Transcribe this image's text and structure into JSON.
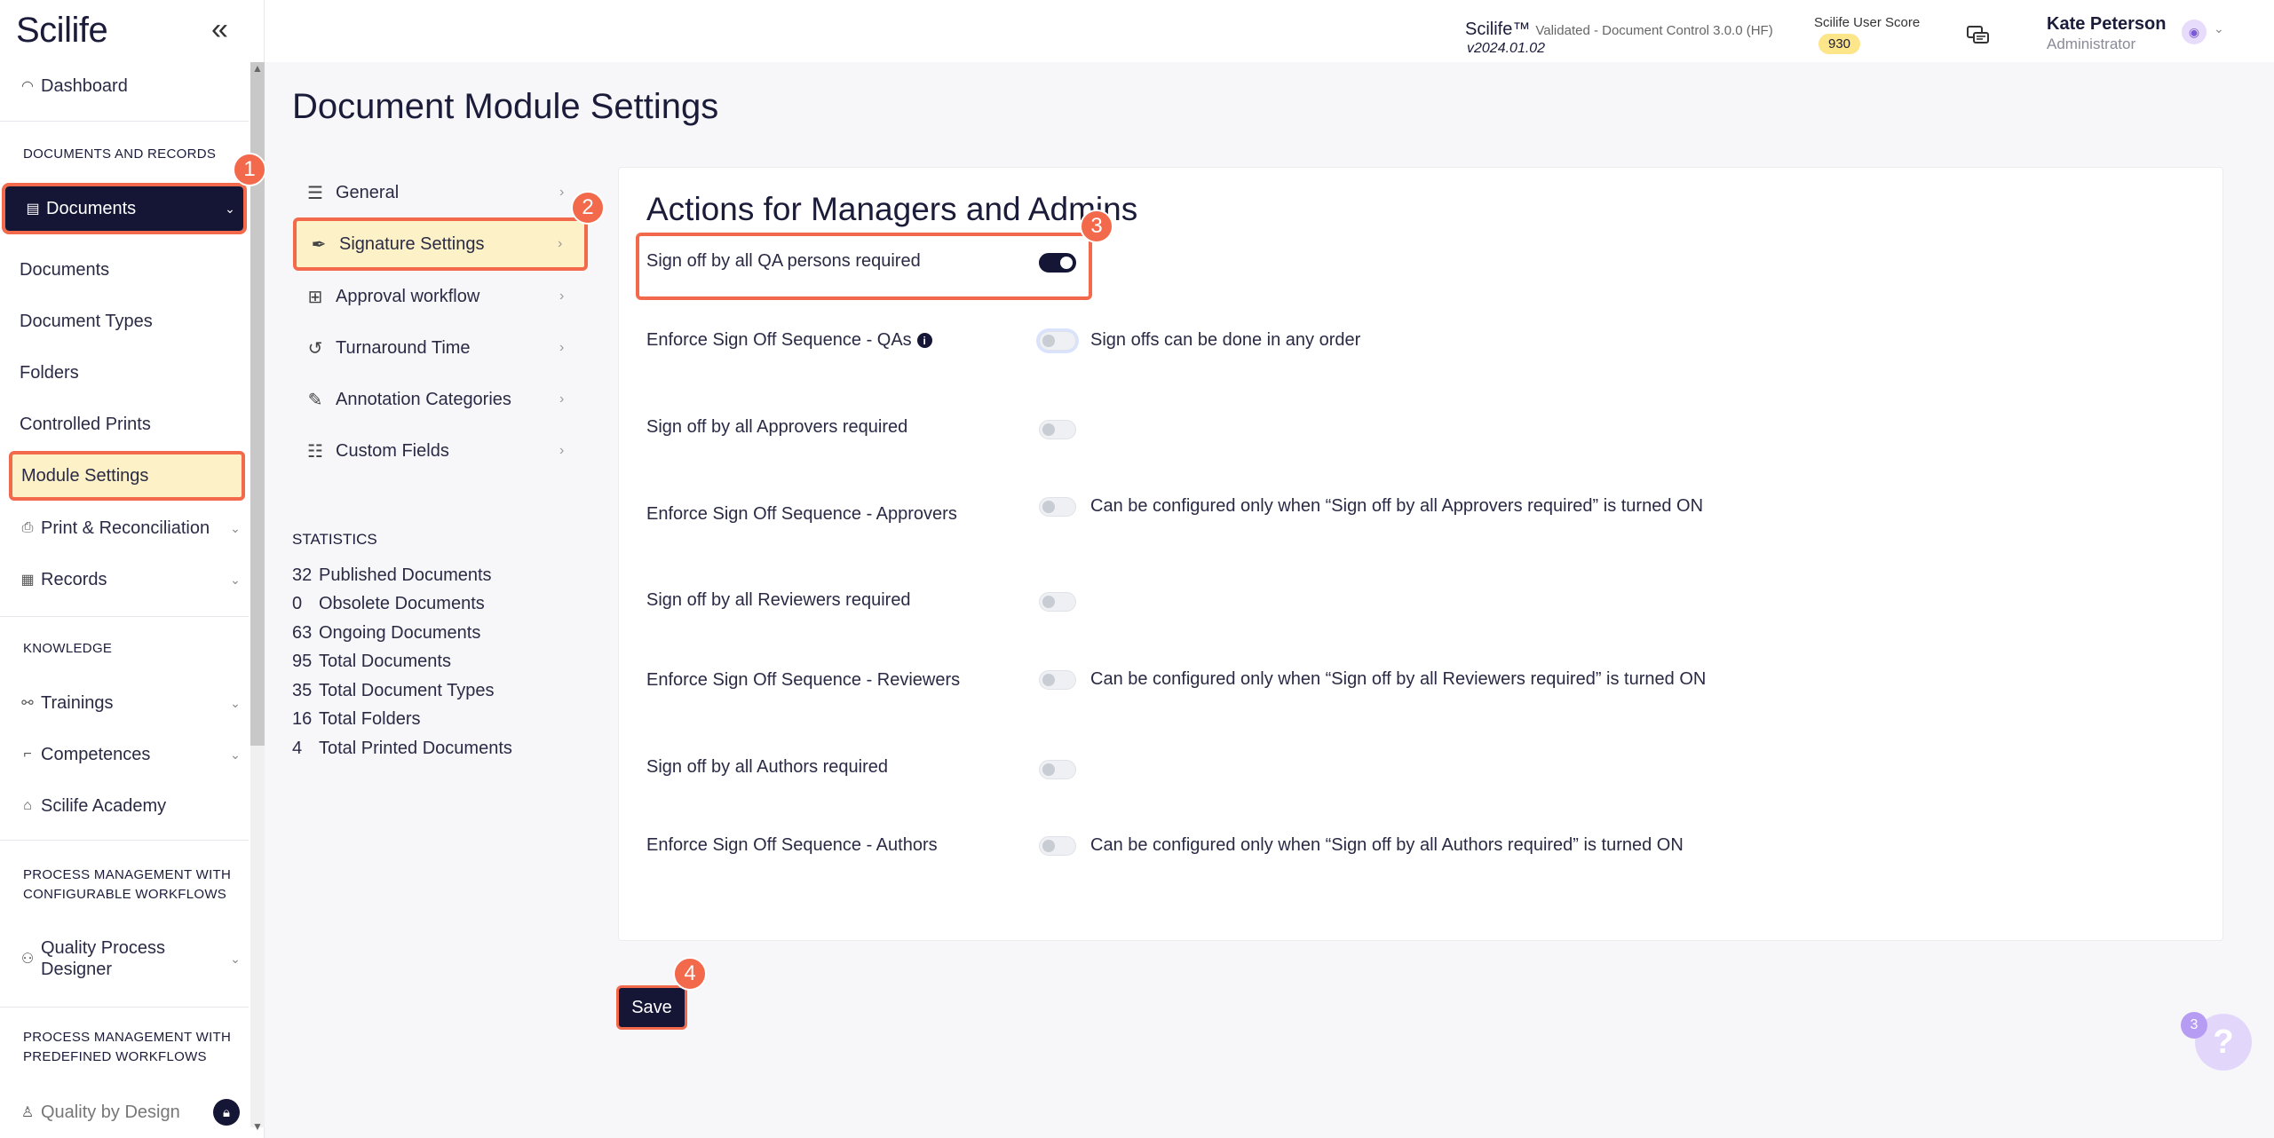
{
  "sidebar": {
    "logo": "Scilife",
    "collapse_icon": "double-chevron-left-icon",
    "dashboard": "Dashboard",
    "section_docs_records": "DOCUMENTS AND RECORDS",
    "documents_group": "Documents",
    "sub_items": [
      "Documents",
      "Document Types",
      "Folders",
      "Controlled Prints",
      "Module Settings"
    ],
    "print_reconciliation": "Print & Reconciliation",
    "records": "Records",
    "section_knowledge": "KNOWLEDGE",
    "trainings": "Trainings",
    "competences": "Competences",
    "academy": "Scilife Academy",
    "section_configurable": "PROCESS MANAGEMENT WITH CONFIGURABLE WORKFLOWS",
    "quality_process_designer": "Quality Process Designer",
    "section_predefined": "PROCESS MANAGEMENT WITH PREDEFINED WORKFLOWS",
    "quality_by_design": "Quality by Design"
  },
  "header": {
    "app_name": "Scilife™",
    "app_validated": "Validated - Document Control 3.0.0 (HF)",
    "app_version": "v2024.01.02",
    "score_label": "Scilife User Score",
    "score_value": "930",
    "user_name": "Kate Peterson",
    "user_role": "Administrator"
  },
  "page": {
    "title": "Document Module Settings"
  },
  "settings_menu": [
    {
      "label": "General",
      "icon": "sliders-icon"
    },
    {
      "label": "Signature Settings",
      "icon": "pen-icon"
    },
    {
      "label": "Approval workflow",
      "icon": "workflow-icon"
    },
    {
      "label": "Turnaround Time",
      "icon": "history-icon"
    },
    {
      "label": "Annotation Categories",
      "icon": "edit-icon"
    },
    {
      "label": "Custom Fields",
      "icon": "list-icon"
    }
  ],
  "statistics": {
    "heading": "STATISTICS",
    "items": [
      {
        "count": "32",
        "label": "Published Documents"
      },
      {
        "count": "0",
        "label": "Obsolete Documents"
      },
      {
        "count": "63",
        "label": "Ongoing Documents"
      },
      {
        "count": "95",
        "label": "Total Documents"
      },
      {
        "count": "35",
        "label": "Total Document Types"
      },
      {
        "count": "16",
        "label": "Total Folders"
      },
      {
        "count": "4",
        "label": "Total Printed Documents"
      }
    ]
  },
  "panel": {
    "title": "Actions for Managers and Admins",
    "settings": [
      {
        "label": "Sign off by all QA persons required",
        "on": true,
        "note": ""
      },
      {
        "label": "Enforce Sign Off Sequence - QAs",
        "on": false,
        "note": "Sign offs can be done in any order"
      },
      {
        "label": "Sign off by all Approvers required",
        "on": false,
        "note": ""
      },
      {
        "label": "Enforce Sign Off Sequence - Approvers",
        "on": false,
        "note": "Can be configured only when “Sign off by all Approvers required” is turned ON"
      },
      {
        "label": "Sign off by all Reviewers required",
        "on": false,
        "note": ""
      },
      {
        "label": "Enforce Sign Off Sequence - Reviewers",
        "on": false,
        "note": "Can be configured only when “Sign off by all Reviewers required” is turned ON"
      },
      {
        "label": "Sign off by all Authors required",
        "on": false,
        "note": ""
      },
      {
        "label": "Enforce Sign Off Sequence - Authors",
        "on": false,
        "note": "Can be configured only when “Sign off by all Authors required” is turned ON"
      }
    ],
    "save_label": "Save"
  },
  "steps": [
    "1",
    "2",
    "3",
    "4"
  ],
  "help": {
    "icon": "question-icon",
    "count": "3"
  },
  "colors": {
    "navy": "#151536",
    "highlight": "#fdf1c7",
    "annotation": "#f26a4b",
    "score_badge": "#fde58a"
  }
}
